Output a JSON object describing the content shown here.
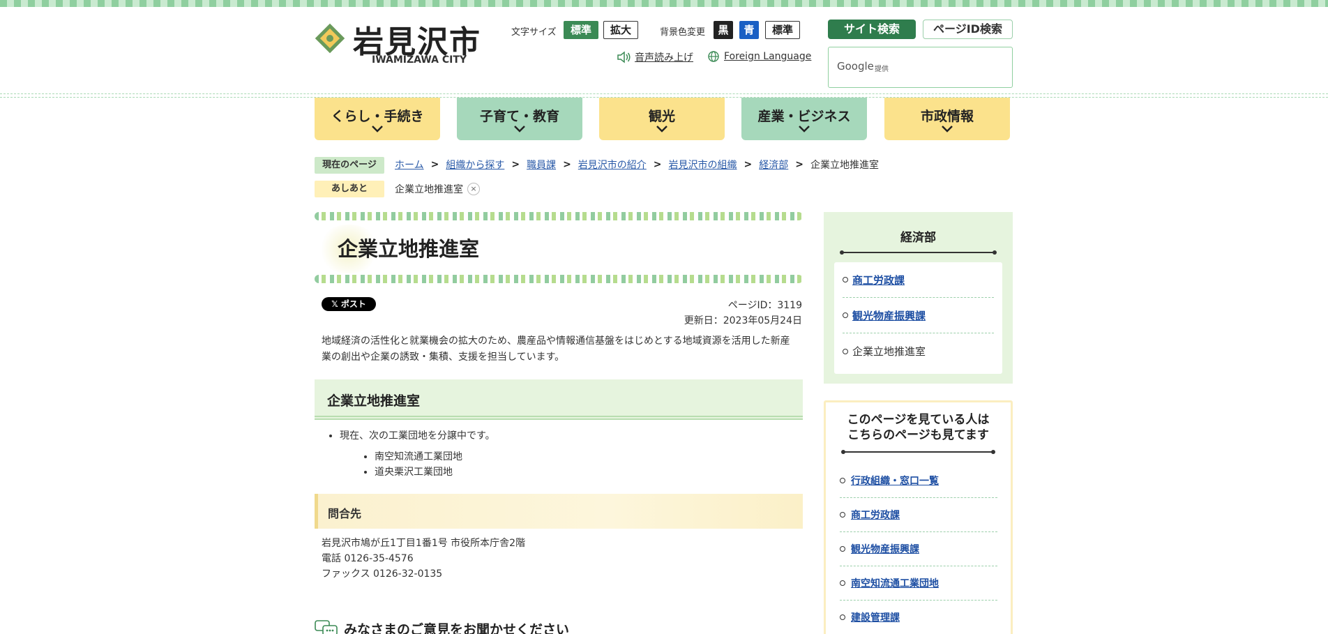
{
  "site": {
    "name": "岩見沢市",
    "name_en": "IWAMIZAWA CITY"
  },
  "header": {
    "font_size_label": "文字サイズ",
    "font_size_options": [
      "標準",
      "拡大"
    ],
    "bg_color_label": "背景色変更",
    "bg_color_options": [
      "黒",
      "青",
      "標準"
    ],
    "read_aloud": "音声読み上げ",
    "foreign_language": "Foreign Language",
    "search_tabs": [
      "サイト検索",
      "ページID検索"
    ],
    "search_provider": "Google",
    "search_provided": "提供"
  },
  "gnav": [
    "くらし・手続き",
    "子育て・教育",
    "観光",
    "産業・ビジネス",
    "市政情報"
  ],
  "breadcrumb": {
    "current_label": "現在のページ",
    "items": [
      "ホーム",
      "組織から探す",
      "職員課",
      "岩見沢市の紹介",
      "岩見沢市の組織",
      "経済部"
    ],
    "current": "企業立地推進室",
    "ashiato_label": "あしあと",
    "ashiato_item": "企業立地推進室",
    "close": "×"
  },
  "main": {
    "title": "企業立地推進室",
    "post_button": "𝕏 ポスト",
    "page_id": "ページID：3119",
    "updated": "更新日：2023年05月24日",
    "lead": "地域経済の活性化と就業機会の拡大のため、農産品や情報通信基盤をはじめとする地域資源を活用した新産業の創出や企業の誘致・集積、支援を担当しています。",
    "section_heading": "企業立地推進室",
    "list_item": "現在、次の工業団地を分譲中です。",
    "sub_items": [
      "南空知流通工業団地",
      "道央栗沢工業団地"
    ],
    "contact_heading": "問合先",
    "contact_lines": [
      "岩見沢市鳩が丘1丁目1番1号 市役所本庁舎2階",
      "電話 0126-35-4576",
      "ファックス 0126-32-0135"
    ],
    "feedback_heading": "みなさまのご意見をお聞かせください"
  },
  "sidebar": {
    "dept_title": "経済部",
    "dept_items": [
      {
        "label": "商工労政課",
        "link": true
      },
      {
        "label": "観光物産振興課",
        "link": true
      },
      {
        "label": "企業立地推進室",
        "link": false
      }
    ],
    "related_title_1": "このページを見ている人は",
    "related_title_2": "こちらのページも見てます",
    "related_items": [
      "行政組織・窓口一覧",
      "商工労政課",
      "観光物産振興課",
      "南空知流通工業団地",
      "建設管理課"
    ]
  },
  "colors": {
    "accent_green": "#3b8a55",
    "nav_yellow": "#fbe28c",
    "nav_green": "#a6d8bb",
    "link_blue": "#2a5aa8"
  }
}
